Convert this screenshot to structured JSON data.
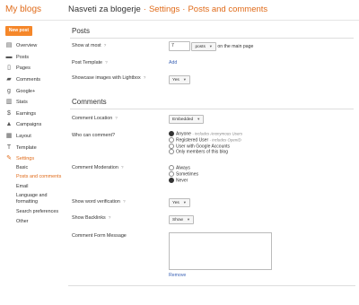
{
  "header": {
    "brand": "My blogs",
    "crumb1": "Nasveti za blogerje",
    "sep": "·",
    "crumb2": "Settings",
    "crumb3": "Posts and comments"
  },
  "sidebar": {
    "new_post": "New post",
    "items": [
      {
        "label": "Overview",
        "icon": "overview-icon"
      },
      {
        "label": "Posts",
        "icon": "posts-icon"
      },
      {
        "label": "Pages",
        "icon": "pages-icon"
      },
      {
        "label": "Comments",
        "icon": "comments-icon"
      },
      {
        "label": "Google+",
        "icon": "google-plus-icon"
      },
      {
        "label": "Stats",
        "icon": "stats-icon"
      },
      {
        "label": "Earnings",
        "icon": "earnings-icon"
      },
      {
        "label": "Campaigns",
        "icon": "campaigns-icon"
      },
      {
        "label": "Layout",
        "icon": "layout-icon"
      },
      {
        "label": "Template",
        "icon": "template-icon"
      },
      {
        "label": "Settings",
        "icon": "settings-icon"
      }
    ],
    "sub": [
      "Basic",
      "Posts and comments",
      "Email",
      "Language and formatting",
      "Search preferences",
      "Other"
    ]
  },
  "posts": {
    "heading": "Posts",
    "show_at_most_label": "Show at most",
    "show_at_most_value": "7",
    "show_unit": "posts",
    "show_suffix": "on the main page",
    "template_label": "Post Template",
    "template_add": "Add",
    "lightbox_label": "Showcase images with Lightbox",
    "lightbox_value": "Yes"
  },
  "comments": {
    "heading": "Comments",
    "location_label": "Comment Location",
    "location_value": "Embedded",
    "who_label": "Who can comment?",
    "who_options": [
      {
        "label": "Anyone",
        "note": "- includes Anonymous Users",
        "selected": true
      },
      {
        "label": "Registered User",
        "note": "- includes OpenID",
        "selected": false
      },
      {
        "label": "User with Google Accounts",
        "note": "",
        "selected": false
      },
      {
        "label": "Only members of this blog",
        "note": "",
        "selected": false
      }
    ],
    "moderation_label": "Comment Moderation",
    "moderation_options": [
      {
        "label": "Always",
        "selected": false
      },
      {
        "label": "Sometimes",
        "selected": false
      },
      {
        "label": "Never",
        "selected": true
      }
    ],
    "verification_label": "Show word verification",
    "verification_value": "Yes",
    "backlinks_label": "Show Backlinks",
    "backlinks_value": "Show",
    "form_message_label": "Comment Form Message",
    "remove": "Remove"
  },
  "help": "?"
}
